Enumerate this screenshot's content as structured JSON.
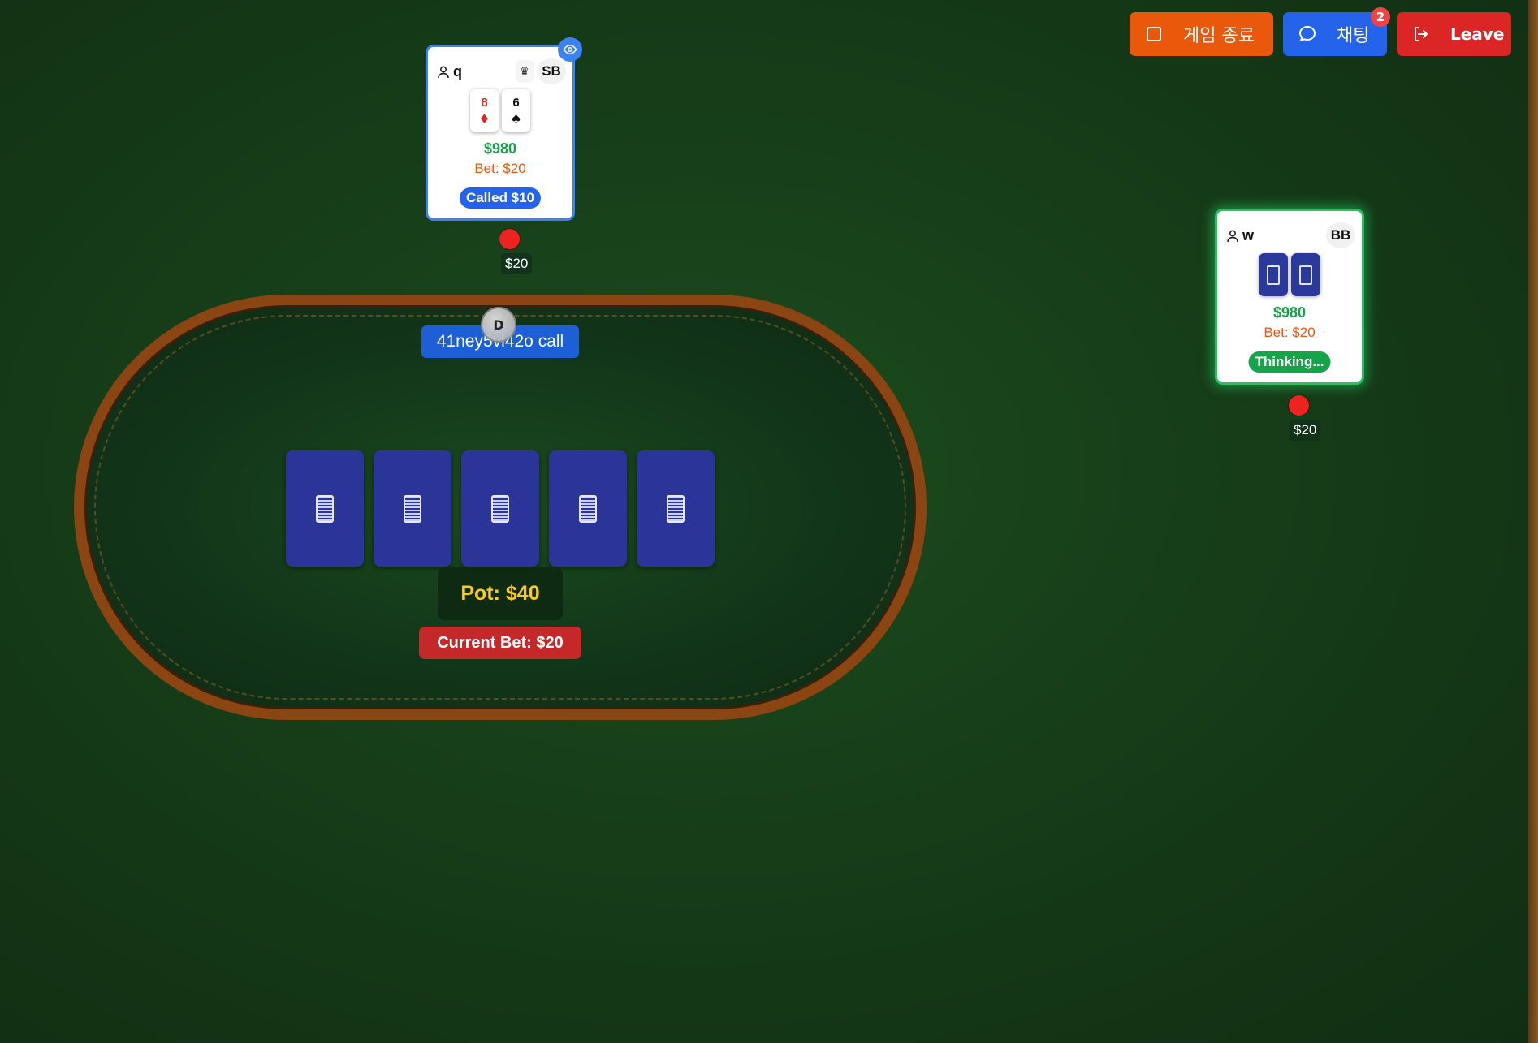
{
  "header": {
    "end_game_label": "게임 종료",
    "chat_label": "채팅",
    "chat_badge": "2",
    "leave_label": "Leave"
  },
  "players": [
    {
      "name": "q",
      "position": "SB",
      "has_crown_icon": true,
      "has_eye_icon": true,
      "cards": [
        {
          "rank": "8",
          "suit": "♦",
          "color": "#dc2626"
        },
        {
          "rank": "6",
          "suit": "♠",
          "color": "#111111"
        }
      ],
      "chips": "$980",
      "bet": "Bet: $20",
      "status": "Called $10",
      "table_bet": "$20",
      "highlight_color": "#3b82f6"
    },
    {
      "name": "w",
      "position": "BB",
      "cards_hidden": true,
      "chips": "$980",
      "bet": "Bet: $20",
      "status": "Thinking...",
      "table_bet": "$20",
      "highlight_color": "#22c55e"
    }
  ],
  "table": {
    "dealer_button": "D",
    "last_action": "41ney5vl42o call",
    "community_cards": [
      "hidden",
      "hidden",
      "hidden",
      "hidden",
      "hidden"
    ],
    "pot": "Pot: $40",
    "current_bet": "Current Bet: $20"
  },
  "colors": {
    "felt": "#163d18",
    "rail": "#8b4513",
    "card_back": "#2b3599",
    "pot_text": "#facc15"
  }
}
